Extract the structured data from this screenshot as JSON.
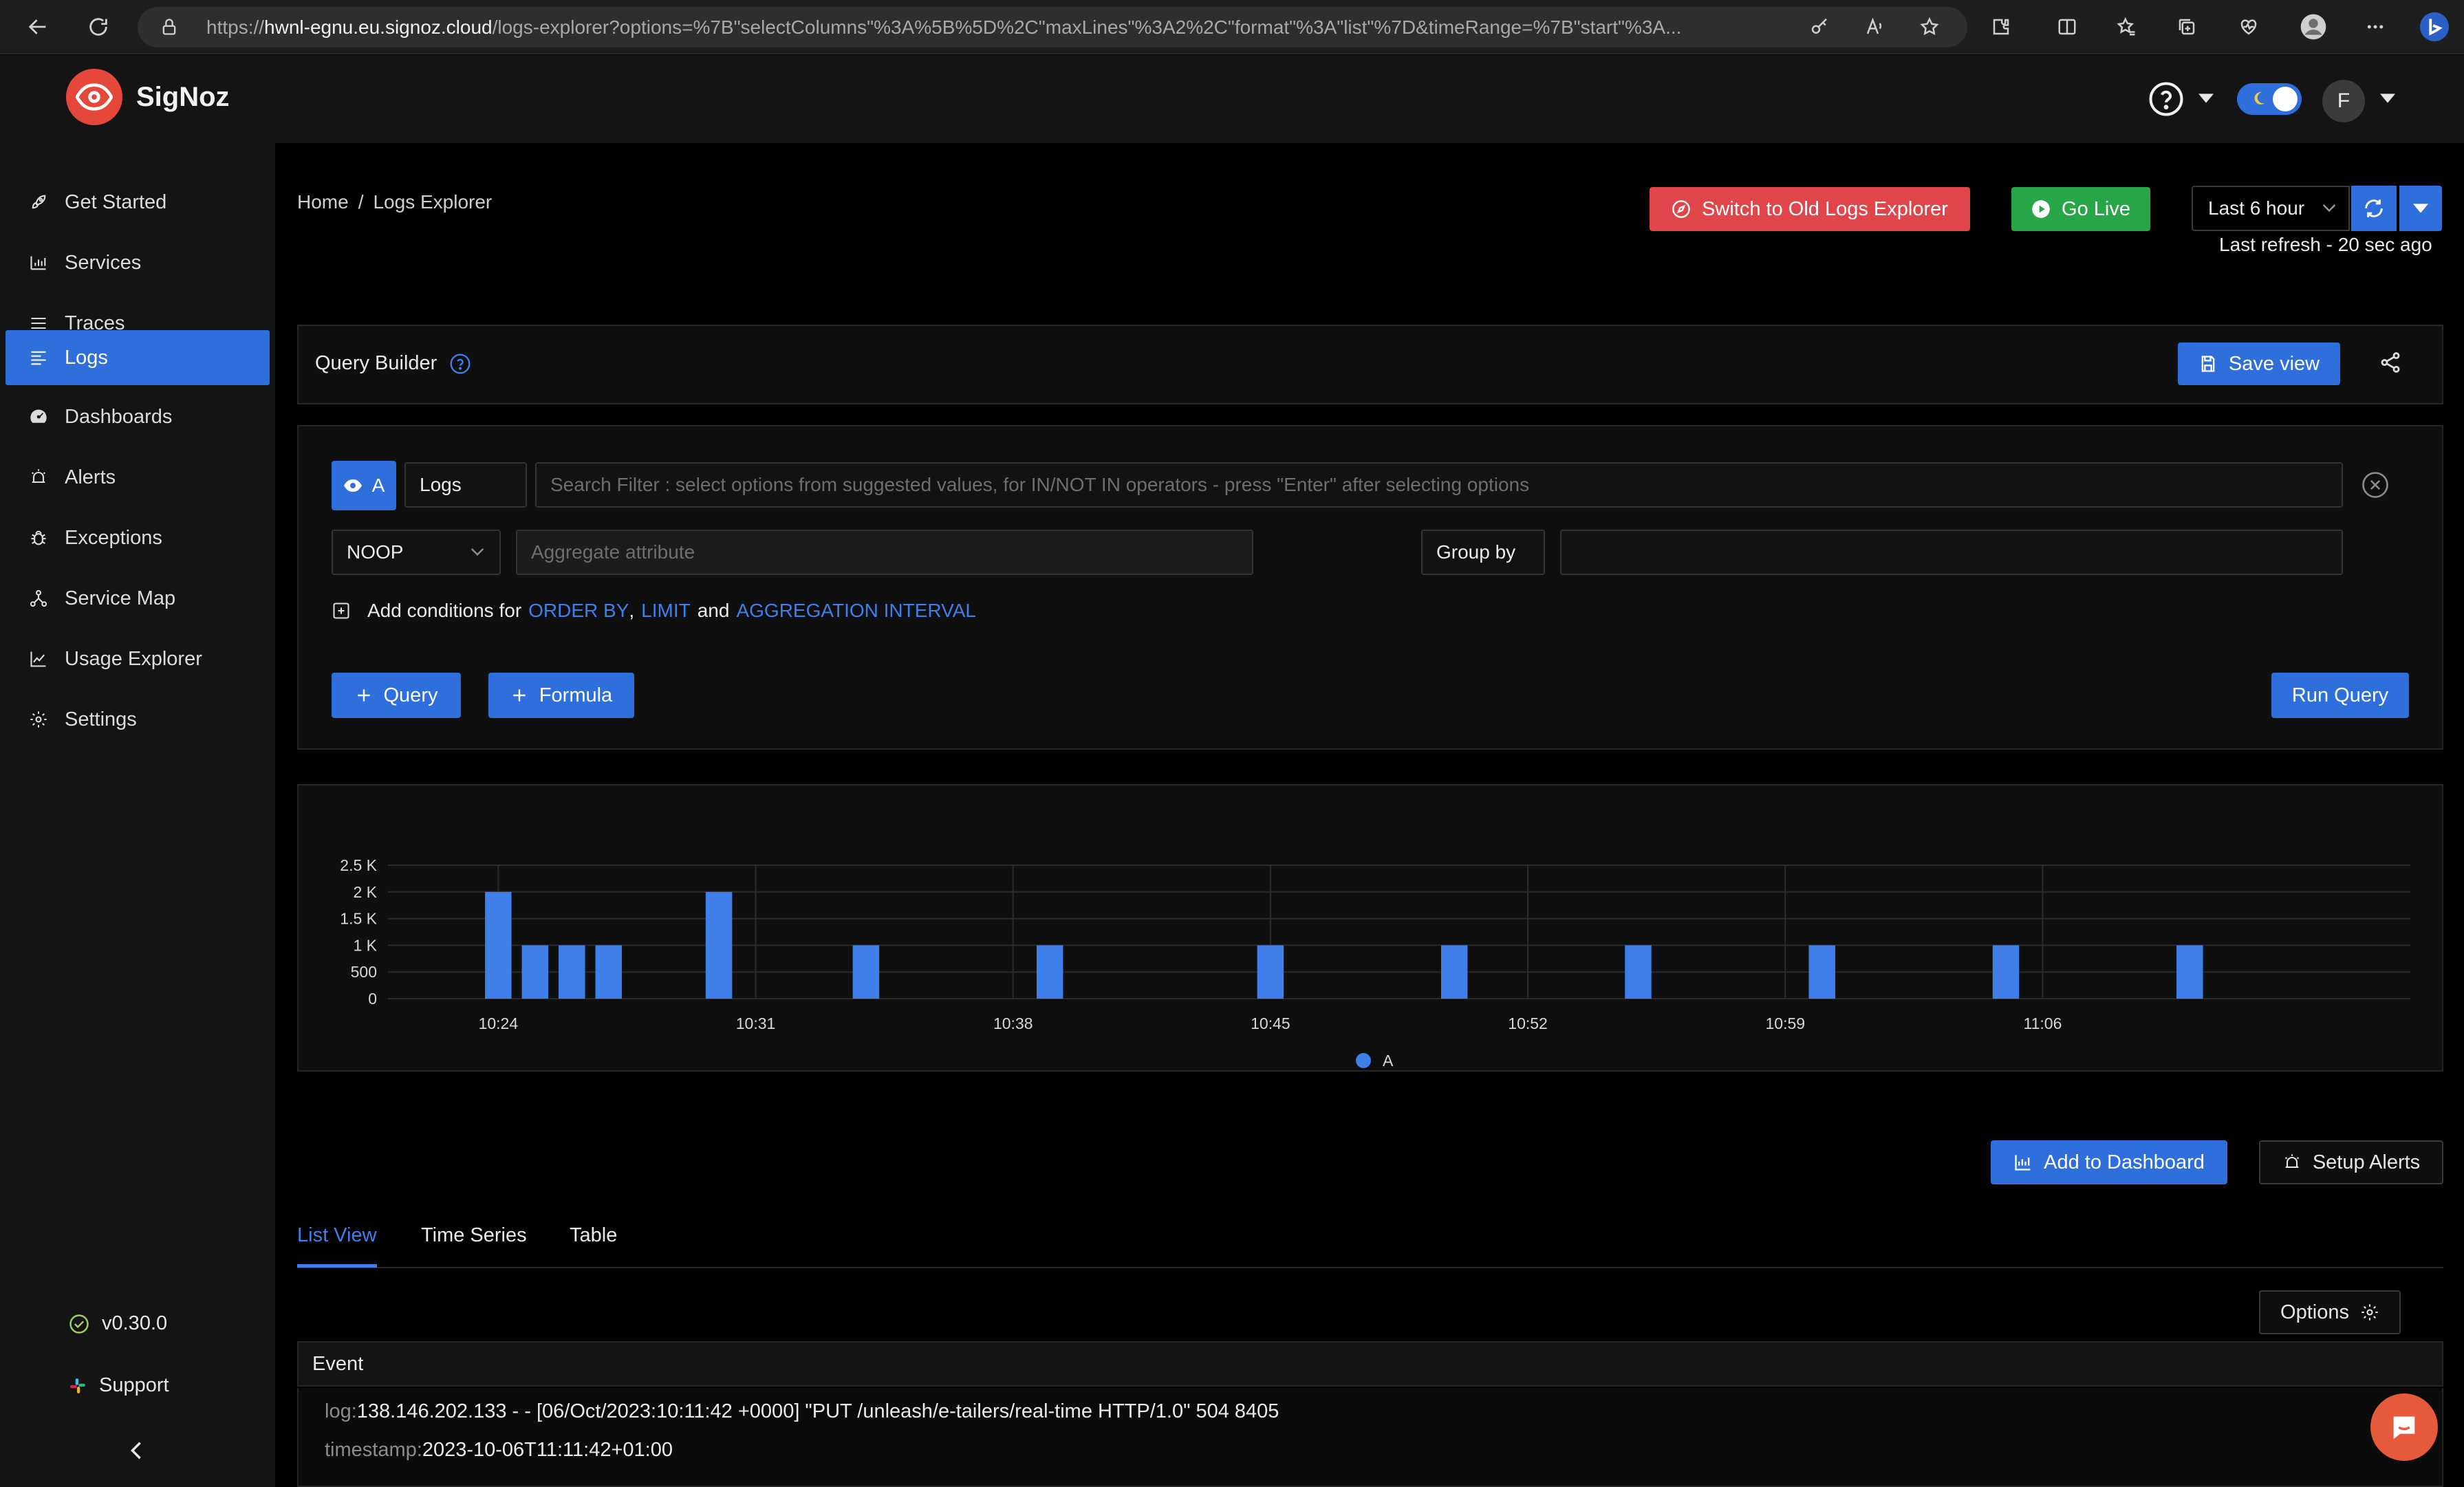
{
  "browser": {
    "url_prefix": "https://",
    "url_host": "hwnl-egnu.eu.signoz.cloud",
    "url_rest": "/logs-explorer?options=%7B\"selectColumns\"%3A%5B%5D%2C\"maxLines\"%3A2%2C\"format\"%3A\"list\"%7D&timeRange=%7B\"start\"%3A..."
  },
  "app": {
    "brand": "SigNoz",
    "avatar_letter": "F",
    "help_icon": "question-circle-icon"
  },
  "sidebar": {
    "items": [
      {
        "label": "Get Started",
        "icon": "rocket-icon"
      },
      {
        "label": "Services",
        "icon": "bar-chart-icon"
      },
      {
        "label": "Traces",
        "icon": "menu-icon"
      },
      {
        "label": "Logs",
        "icon": "align-left-icon",
        "active": true
      },
      {
        "label": "Dashboards",
        "icon": "dashboard-icon"
      },
      {
        "label": "Alerts",
        "icon": "alarm-icon"
      },
      {
        "label": "Exceptions",
        "icon": "bug-icon"
      },
      {
        "label": "Service Map",
        "icon": "deployment-icon"
      },
      {
        "label": "Usage Explorer",
        "icon": "line-chart-icon"
      },
      {
        "label": "Settings",
        "icon": "gear-icon"
      }
    ],
    "version": "v0.30.0",
    "support": "Support"
  },
  "breadcrumb": {
    "home": "Home",
    "separator": "/",
    "current": "Logs Explorer"
  },
  "top_actions": {
    "switch_old": "Switch to Old Logs Explorer",
    "go_live": "Go Live",
    "time_range": "Last 6 hour",
    "last_refresh": "Last refresh - 20 sec ago"
  },
  "query_builder": {
    "title": "Query Builder",
    "save_view": "Save view",
    "query_letter": "A",
    "datasource": "Logs",
    "search_placeholder": "Search Filter : select options from suggested values, for IN/NOT IN operators - press \"Enter\" after selecting options",
    "aggregate_op": "NOOP",
    "aggregate_placeholder": "Aggregate attribute",
    "group_by": "Group by",
    "add_conditions_prefix": "Add conditions for",
    "order_by": "ORDER BY",
    "comma": ",",
    "limit": "LIMIT",
    "and": "and",
    "aggregation_interval": "AGGREGATION INTERVAL",
    "add_query": "Query",
    "add_formula": "Formula",
    "run_query": "Run Query"
  },
  "chart_data": {
    "type": "bar",
    "series": [
      {
        "name": "A",
        "color": "#3f7fe9"
      }
    ],
    "ylim": [
      0,
      2500
    ],
    "y_ticks": [
      0,
      500,
      1000,
      1500,
      2000,
      2500
    ],
    "y_tick_labels": [
      "0",
      "500",
      "1 K",
      "1.5 K",
      "2 K",
      "2.5 K"
    ],
    "x_range_minutes": [
      0,
      55
    ],
    "x_ticks": [
      {
        "minute": 3,
        "label": "10:24"
      },
      {
        "minute": 10,
        "label": "10:31"
      },
      {
        "minute": 17,
        "label": "10:38"
      },
      {
        "minute": 24,
        "label": "10:45"
      },
      {
        "minute": 31,
        "label": "10:52"
      },
      {
        "minute": 38,
        "label": "10:59"
      },
      {
        "minute": 45,
        "label": "11:06"
      }
    ],
    "points": [
      {
        "minute": 3.0,
        "value": 2000
      },
      {
        "minute": 4.0,
        "value": 1000
      },
      {
        "minute": 5.0,
        "value": 1000
      },
      {
        "minute": 6.0,
        "value": 1000
      },
      {
        "minute": 9.0,
        "value": 2000
      },
      {
        "minute": 13.0,
        "value": 1000
      },
      {
        "minute": 18.0,
        "value": 1000
      },
      {
        "minute": 24.0,
        "value": 1000
      },
      {
        "minute": 29.0,
        "value": 1000
      },
      {
        "minute": 34.0,
        "value": 1000
      },
      {
        "minute": 39.0,
        "value": 1000
      },
      {
        "minute": 44.0,
        "value": 1000
      },
      {
        "minute": 49.0,
        "value": 1000
      }
    ],
    "legend": "A",
    "legend_placement": "bottom-center"
  },
  "actions": {
    "add_to_dashboard": "Add to Dashboard",
    "setup_alerts": "Setup Alerts"
  },
  "views": {
    "tabs": [
      "List View",
      "Time Series",
      "Table"
    ],
    "active": 0,
    "options": "Options",
    "column_header": "Event"
  },
  "log": {
    "log_key": "log:",
    "log_value": "138.146.202.133 - - [06/Oct/2023:10:11:42 +0000] \"PUT /unleash/e-tailers/real-time HTTP/1.0\" 504 8405",
    "timestamp_key": "timestamp:",
    "timestamp_value": "2023-10-06T11:11:42+01:00"
  }
}
